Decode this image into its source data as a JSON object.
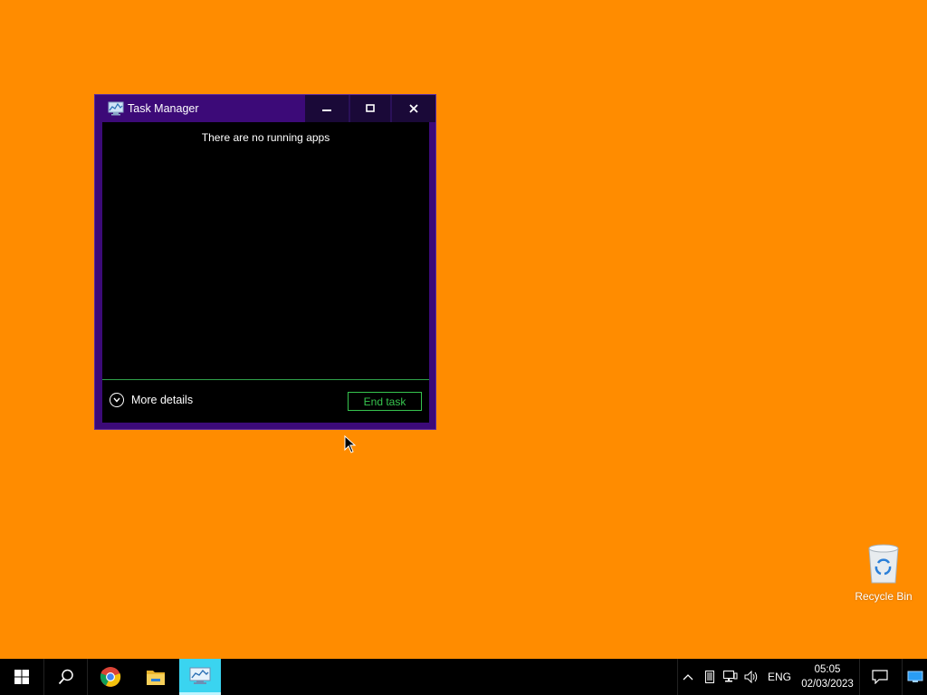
{
  "window": {
    "title": "Task Manager",
    "empty_message": "There are no running apps",
    "more_details_label": "More details",
    "end_task_label": "End task"
  },
  "desktop": {
    "recycle_bin_label": "Recycle Bin"
  },
  "taskbar": {
    "language": "ENG",
    "time": "05:05",
    "date": "02/03/2023"
  },
  "colors": {
    "desktop_bg": "#ff8c00",
    "window_frame": "#3c0a78",
    "accent_green": "#36c44e",
    "active_app": "#3ad4f0"
  },
  "icons": {
    "start": "windows-start-icon",
    "search": "search-icon",
    "chrome": "chrome-icon",
    "explorer": "file-explorer-icon",
    "task_manager": "task-manager-icon",
    "tray": [
      "chevron-up-icon",
      "tablet-icon",
      "network-icon",
      "volume-icon",
      "notification-icon",
      "show-desktop-icon"
    ]
  }
}
